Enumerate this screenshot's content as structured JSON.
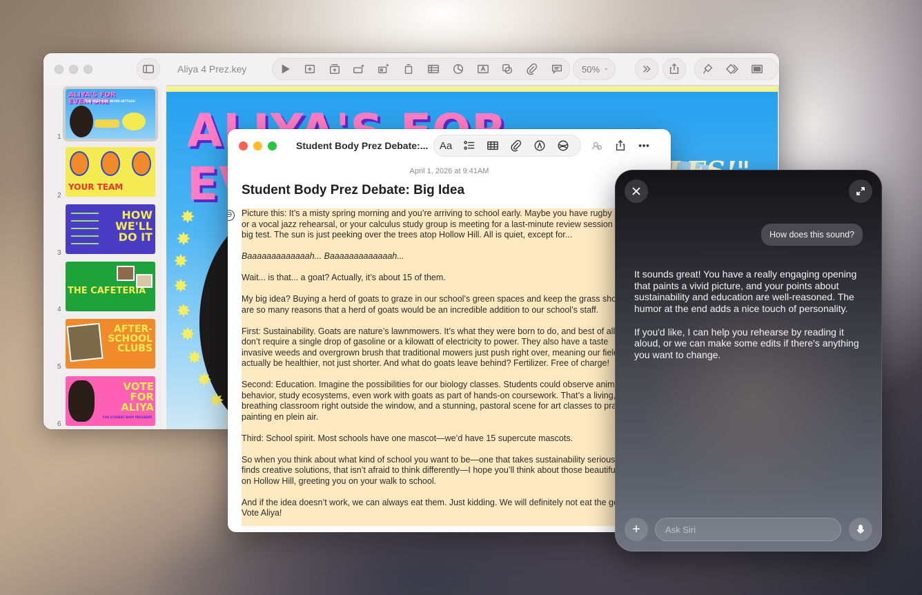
{
  "keynote": {
    "title": "Aliya 4 Prez.key",
    "zoom": "50%",
    "slides": [
      {
        "number": "1",
        "text": "ALIYA'S FOR EVERYONE",
        "sub": "THE PREZ WHO NEVER SETTLES!"
      },
      {
        "number": "2",
        "text": "YOUR TEAM"
      },
      {
        "number": "3",
        "text": "HOW WE'LL DO IT"
      },
      {
        "number": "4",
        "text": "THE CAFETERIA"
      },
      {
        "number": "5",
        "text": "AFTER-SCHOOL CLUBS"
      },
      {
        "number": "6",
        "text": "VOTE FOR ALIYA",
        "sub": "FOR STUDENT BODY PRESIDENT"
      }
    ],
    "main_slide": {
      "headline": "ALIYA'S FOR EVERYONE",
      "subtitle": "TLES!\""
    }
  },
  "notes": {
    "window_title": "Student Body Prez Debate:...",
    "date": "April 1, 2026 at 9:41AM",
    "heading": "Student Body Prez Debate: Big Idea",
    "format_label": "Aa",
    "collapse_symbol": "⊖",
    "paragraphs": [
      [
        "Picture this: It’s a misty spring morning and you’re arriving to school early. Maybe you have rugby",
        "or a vocal jazz rehearsal, or your calculus study group is meeting for a last-minute review session",
        "big test. The sun is just peeking over the trees atop Hollow Hill. All is quiet, except for..."
      ],
      [
        "Baaaaaaaaaaaaah... Baaaaaaaaaaaaah..."
      ],
      [
        "Wait... is that... a goat? Actually, it’s about 15 of them."
      ],
      [
        "My big idea? Buying a herd of goats to graze in our school’s green spaces and keep the grass short",
        "are so many reasons that a herd of goats would be an incredible addition to our school’s staff."
      ],
      [
        "First: Sustainability. Goats are nature’s lawnmowers. It’s what they were born to do, and best of all",
        "don’t require a single drop of gasoline or a kilowatt of electricity to power. They also have a taste",
        "invasive weeds and overgrown brush that traditional mowers just push right over, meaning our fields",
        "actually be healthier, not just shorter. And what do goats leave behind? Fertilizer. Free of charge!"
      ],
      [
        "Second: Education. Imagine the possibilities for our biology classes. Students could observe animal",
        "behavior, study ecosystems, even work with goats as part of hands-on coursework. That’s a living,",
        "breathing classroom right outside the window, and a stunning, pastoral scene for art classes to practice",
        "painting en plein air."
      ],
      [
        "Third: School spirit. Most schools have one mascot—we’d have 15 supercute mascots."
      ],
      [
        "So when you think about what kind of school you want to be—one that takes sustainability seriously",
        "finds creative solutions, that isn’t afraid to think differently—I hope you’ll think about those beautiful",
        "on Hollow Hill, greeting you on your walk to school."
      ],
      [
        "And if the idea doesn’t work, we can always eat them. Just kidding. We will definitely not eat the goats.",
        "Vote Aliya!"
      ]
    ]
  },
  "siri": {
    "user_message": "How does this sound?",
    "reply": [
      "It sounds great! You have a really engaging opening that paints a vivid picture, and your points about sustainability and education are well-reasoned. The humor at the end adds a nice touch of personality.",
      "If you'd like, I can help you rehearse by reading it aloud, or we can make some edits if there's anything you want to change."
    ],
    "input_placeholder": "Ask Siri",
    "plus_symbol": "+"
  },
  "colors": {
    "slide_pink": "#ff7ec6",
    "slide_blue": "#26a0f0",
    "slide_yellow": "#f7f190",
    "note_highlight": "#fde9c0",
    "traffic_red": "#fe5f57",
    "traffic_yellow": "#febc2e",
    "traffic_green": "#28c840"
  }
}
